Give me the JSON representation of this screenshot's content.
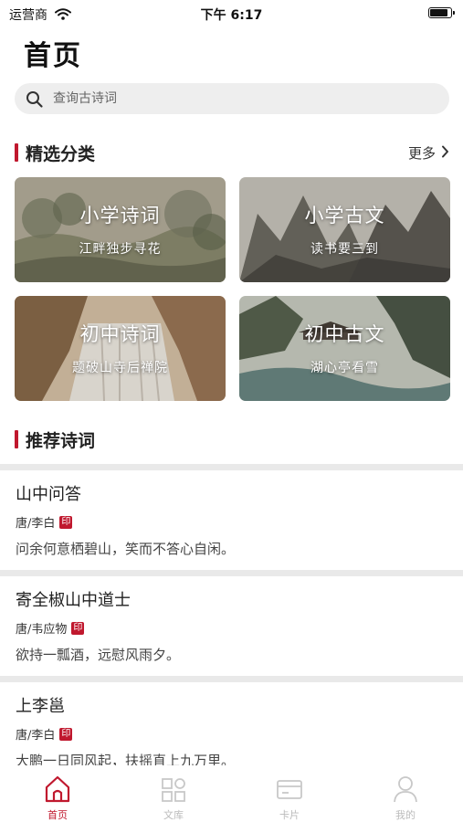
{
  "status_bar": {
    "carrier": "运营商",
    "time": "下午 6:17",
    "battery_level": 0.95
  },
  "page_title": "首页",
  "search": {
    "placeholder": "查询古诗词"
  },
  "featured": {
    "title": "精选分类",
    "more_label": "更多",
    "cards": [
      {
        "title": "小学诗词",
        "subtitle": "江畔独步寻花"
      },
      {
        "title": "小学古文",
        "subtitle": "读书要三到"
      },
      {
        "title": "初中诗词",
        "subtitle": "题破山寺后禅院"
      },
      {
        "title": "初中古文",
        "subtitle": "湖心亭看雪"
      }
    ]
  },
  "recommended": {
    "title": "推荐诗词",
    "poems": [
      {
        "title": "山中问答",
        "author": "唐/李白",
        "seal": "印",
        "line": "问余何意栖碧山，笑而不答心自闲。"
      },
      {
        "title": "寄全椒山中道士",
        "author": "唐/韦应物",
        "seal": "印",
        "line": "欲持一瓢酒，远慰风雨夕。"
      },
      {
        "title": "上李邕",
        "author": "唐/李白",
        "seal": "印",
        "line": "大鹏一日同风起，扶摇直上九万里。"
      }
    ]
  },
  "tabbar": {
    "tabs": [
      {
        "label": "首页",
        "icon": "home-icon",
        "active": true
      },
      {
        "label": "文库",
        "icon": "grid-icon",
        "active": false
      },
      {
        "label": "卡片",
        "icon": "card-icon",
        "active": false
      },
      {
        "label": "我的",
        "icon": "user-icon",
        "active": false
      }
    ]
  },
  "colors": {
    "accent": "#c0182e",
    "search_bg": "#eeeeee",
    "divider": "#e9e9e9"
  }
}
